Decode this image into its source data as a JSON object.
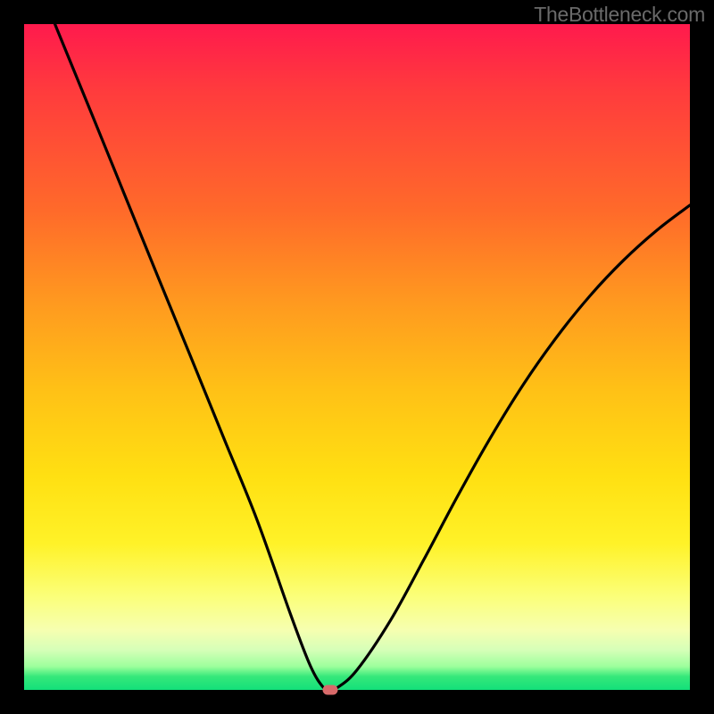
{
  "watermark": "TheBottleneck.com",
  "chart_data": {
    "type": "line",
    "title": "",
    "xlabel": "",
    "ylabel": "",
    "xlim": [
      0,
      1
    ],
    "ylim": [
      0,
      1
    ],
    "x": [
      0.0,
      0.05,
      0.1,
      0.15,
      0.2,
      0.25,
      0.3,
      0.35,
      0.4,
      0.43,
      0.45,
      0.46,
      0.47,
      0.5,
      0.55,
      0.6,
      0.65,
      0.7,
      0.75,
      0.8,
      0.85,
      0.9,
      0.95,
      1.0
    ],
    "y": [
      1.114,
      0.991,
      0.869,
      0.746,
      0.623,
      0.501,
      0.378,
      0.255,
      0.114,
      0.036,
      0.003,
      0.0,
      0.003,
      0.03,
      0.104,
      0.195,
      0.289,
      0.378,
      0.459,
      0.53,
      0.592,
      0.645,
      0.69,
      0.728
    ],
    "marker": {
      "x": 0.46,
      "y": 0.0
    },
    "gradient_stops": [
      {
        "pos": 0.0,
        "color": "#ff1a4d"
      },
      {
        "pos": 0.28,
        "color": "#ff6a2a"
      },
      {
        "pos": 0.55,
        "color": "#ffc116"
      },
      {
        "pos": 0.78,
        "color": "#fff228"
      },
      {
        "pos": 0.94,
        "color": "#d6ffb8"
      },
      {
        "pos": 1.0,
        "color": "#13e07a"
      }
    ]
  }
}
